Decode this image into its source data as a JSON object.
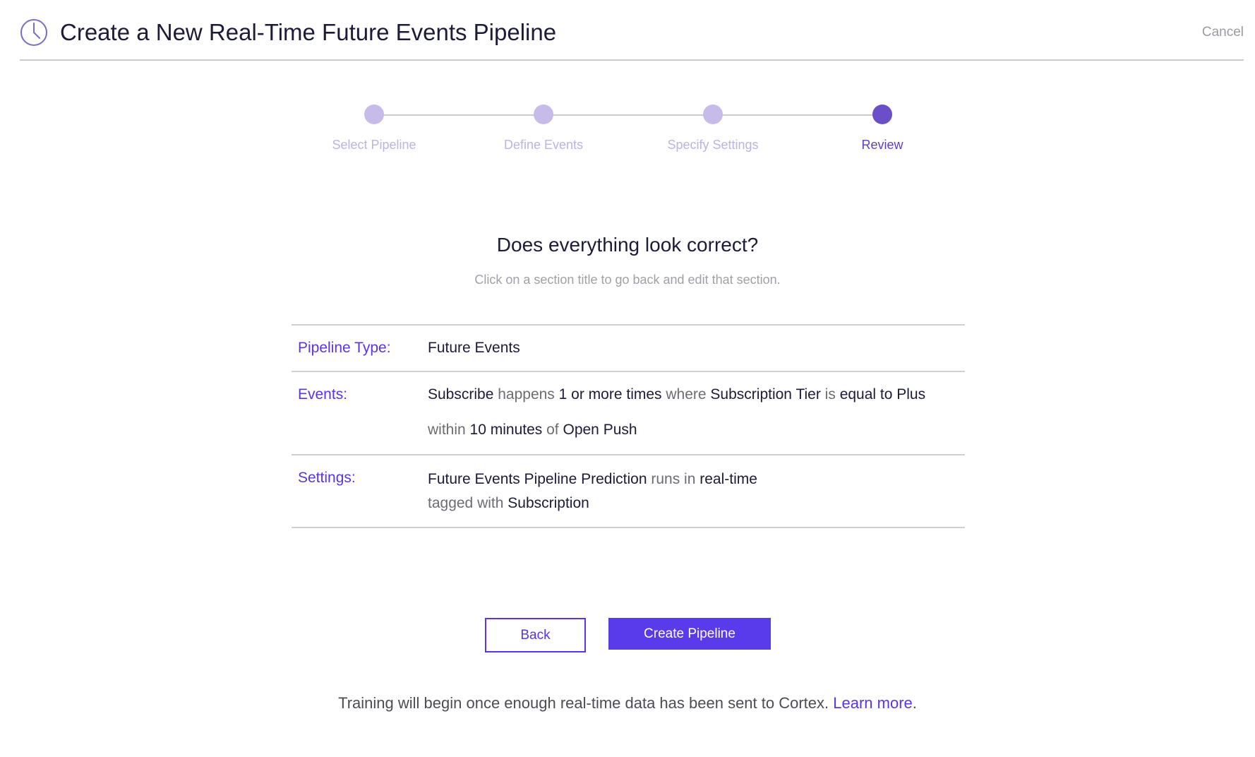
{
  "header": {
    "title": "Create a New Real-Time Future Events Pipeline",
    "cancel_label": "Cancel",
    "icon": "clock-icon"
  },
  "stepper": {
    "steps": [
      {
        "label": "Select Pipeline",
        "state": "complete"
      },
      {
        "label": "Define Events",
        "state": "complete"
      },
      {
        "label": "Specify Settings",
        "state": "complete"
      },
      {
        "label": "Review",
        "state": "active"
      }
    ]
  },
  "review": {
    "heading": "Does everything look correct?",
    "subheading": "Click on a section title to go back and edit that section."
  },
  "summary": {
    "pipeline_type": {
      "label": "Pipeline Type:",
      "value": "Future Events"
    },
    "events": {
      "label": "Events:",
      "event_name": "Subscribe",
      "happens_word": "happens",
      "frequency": "1 or more times",
      "where_word": "where",
      "property": "Subscription Tier",
      "is_word": "is",
      "condition": "equal to Plus",
      "within_word": "within",
      "window": "10 minutes",
      "of_word": "of",
      "anchor_event": "Open Push"
    },
    "settings": {
      "label": "Settings:",
      "prediction_name": "Future Events Pipeline Prediction",
      "runs_in_word": "runs in",
      "mode": "real-time",
      "tagged_with_word": "tagged with",
      "tag": "Subscription"
    }
  },
  "buttons": {
    "back_label": "Back",
    "create_label": "Create Pipeline"
  },
  "footer": {
    "note_text": "Training will begin once enough real-time data has been sent to Cortex. ",
    "link_text": "Learn more",
    "trailing": "."
  },
  "colors": {
    "accent": "#5a34e6",
    "step_inactive": "#c7bce9",
    "step_active": "#6a4fc8",
    "divider": "#cfcfd4"
  }
}
